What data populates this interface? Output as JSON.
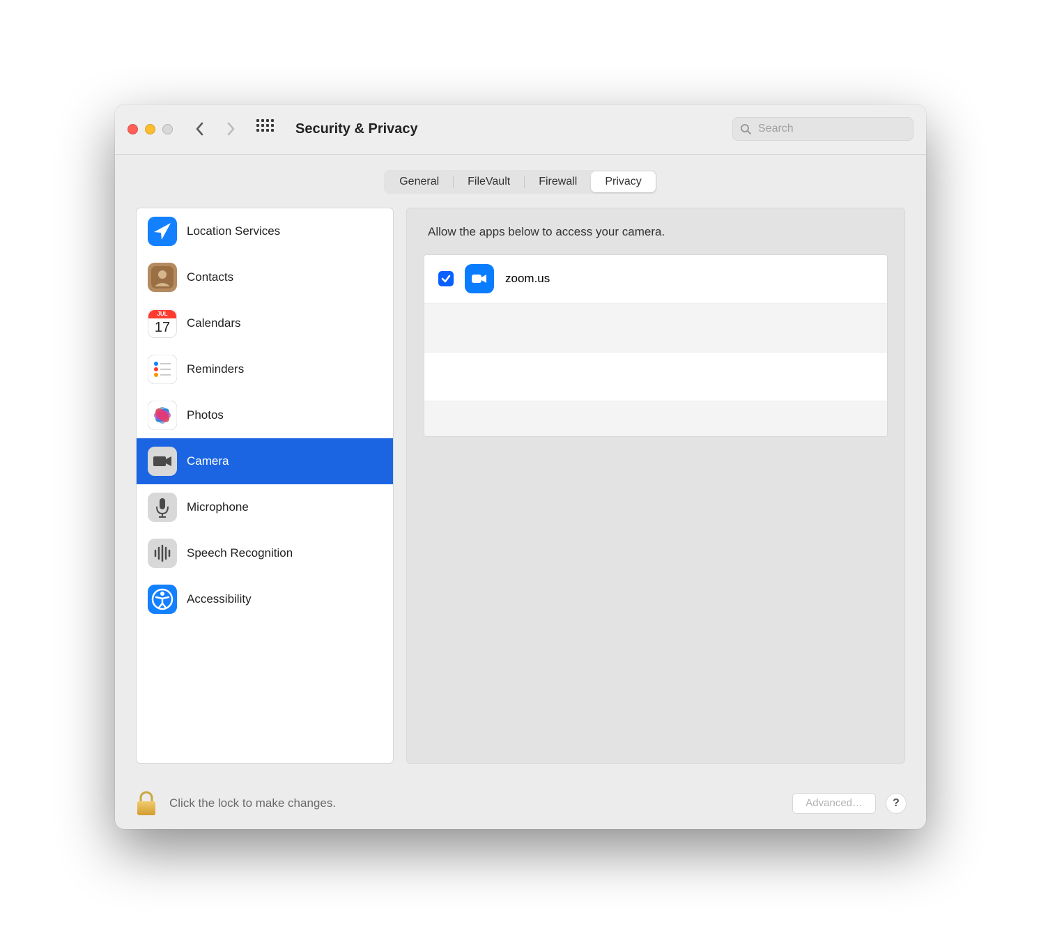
{
  "toolbar": {
    "title": "Security & Privacy",
    "search_placeholder": "Search"
  },
  "tabs": {
    "general": "General",
    "filevault": "FileVault",
    "firewall": "Firewall",
    "privacy": "Privacy"
  },
  "sidebar": {
    "items": [
      {
        "label": "Location Services"
      },
      {
        "label": "Contacts"
      },
      {
        "label": "Calendars"
      },
      {
        "label": "Reminders"
      },
      {
        "label": "Photos"
      },
      {
        "label": "Camera"
      },
      {
        "label": "Microphone"
      },
      {
        "label": "Speech Recognition"
      },
      {
        "label": "Accessibility"
      }
    ]
  },
  "content": {
    "description": "Allow the apps below to access your camera.",
    "apps": [
      {
        "name": "zoom.us",
        "checked": true
      }
    ]
  },
  "footer": {
    "lock_text": "Click the lock to make changes.",
    "advanced": "Advanced…",
    "help": "?"
  },
  "calendar_icon": {
    "month": "JUL",
    "day": "17"
  }
}
